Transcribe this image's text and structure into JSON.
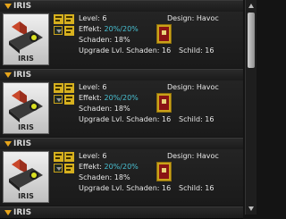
{
  "drones": [
    {
      "header": "IRIS",
      "thumb_label": "IRIS",
      "level": "Level: 6",
      "effekt_label": "Effekt: ",
      "effekt_value": "20%/20%",
      "schaden": "Schaden: 18%",
      "upgrade": "Upgrade Lvl. Schaden: 16",
      "design": "Design: Havoc",
      "schild": "Schild: 16"
    },
    {
      "header": "IRIS",
      "thumb_label": "IRIS",
      "level": "Level: 6",
      "effekt_label": "Effekt: ",
      "effekt_value": "20%/20%",
      "schaden": "Schaden: 18%",
      "upgrade": "Upgrade Lvl. Schaden: 16",
      "design": "Design: Havoc",
      "schild": "Schild: 16"
    },
    {
      "header": "IRIS",
      "thumb_label": "IRIS",
      "level": "Level: 6",
      "effekt_label": "Effekt: ",
      "effekt_value": "20%/20%",
      "schaden": "Schaden: 18%",
      "upgrade": "Upgrade Lvl. Schaden: 16",
      "design": "Design: Havoc",
      "schild": "Schild: 16"
    },
    {
      "header": "IRIS"
    }
  ],
  "colors": {
    "accent": "#e7a51b",
    "percent": "#49c0d2"
  },
  "icons": [
    "collapse-triangle-icon",
    "drone-icon",
    "module-icon",
    "havoc-design-icon",
    "scroll-up-icon",
    "scroll-down-icon"
  ]
}
